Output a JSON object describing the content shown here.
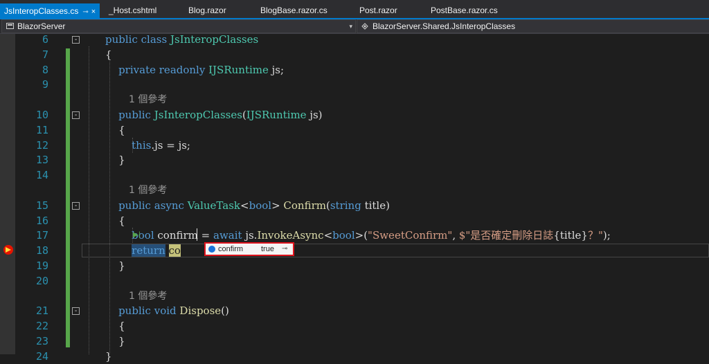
{
  "tabs": [
    {
      "label": "JsInteropClasses.cs",
      "pin": "⊸",
      "close": "×"
    },
    {
      "label": "_Host.cshtml"
    },
    {
      "label": "Blog.razor"
    },
    {
      "label": "BlogBase.razor.cs"
    },
    {
      "label": "Post.razor"
    },
    {
      "label": "PostBase.razor.cs"
    }
  ],
  "nav": {
    "project": "BlazorServer",
    "type": "BlazorServer.Shared.JsInteropClasses",
    "dropdown_glyph": "▾"
  },
  "code_lines": [
    {
      "num": "6",
      "kind": "code",
      "html": "<span class=\"kw\">public</span> <span class=\"kw\">class</span> <span class=\"ty\">JsInteropClasses</span>"
    },
    {
      "num": "7",
      "kind": "code",
      "html": "{"
    },
    {
      "num": "8",
      "kind": "code",
      "html": "    <span class=\"kw\">private</span> <span class=\"kw\">readonly</span> <span class=\"ty\">IJSRuntime</span> js;"
    },
    {
      "num": "9",
      "kind": "code",
      "html": ""
    },
    {
      "num": "",
      "kind": "lens",
      "text": "1 個參考"
    },
    {
      "num": "10",
      "kind": "code",
      "html": "    <span class=\"kw\">public</span> <span class=\"ty\">JsInteropClasses</span>(<span class=\"ty\">IJSRuntime</span> js)"
    },
    {
      "num": "11",
      "kind": "code",
      "html": "    {"
    },
    {
      "num": "12",
      "kind": "code",
      "html": "        <span class=\"kw\">this</span>.js = js;"
    },
    {
      "num": "13",
      "kind": "code",
      "html": "    }"
    },
    {
      "num": "14",
      "kind": "code",
      "html": ""
    },
    {
      "num": "",
      "kind": "lens",
      "text": "1 個參考"
    },
    {
      "num": "15",
      "kind": "code",
      "html": "    <span class=\"kw\">public</span> <span class=\"kw\">async</span> <span class=\"ty\">ValueTask</span>&lt;<span class=\"kw\">bool</span>&gt; <span class=\"mt\">Confirm</span>(<span class=\"kw\">string</span> title)"
    },
    {
      "num": "16",
      "kind": "code",
      "html": "    {"
    },
    {
      "num": "17",
      "kind": "code",
      "html": "        <span class=\"kw\">bool</span> confirm = <span class=\"kw\">await</span> js.<span class=\"mt\">InvokeAsync</span>&lt;<span class=\"kw\">bool</span>&gt;(<span class=\"st\">\"SweetConfirm\"</span>, <span class=\"st\">$\"是否確定刪除日誌</span>{title}<span class=\"st\">？\"</span>);"
    },
    {
      "num": "18",
      "kind": "code",
      "html": "        <span class=\"retsel\"><span class=\"kw\">return</span></span> <span class=\"retword\">co</span>"
    },
    {
      "num": "19",
      "kind": "code",
      "html": "    }"
    },
    {
      "num": "20",
      "kind": "code",
      "html": ""
    },
    {
      "num": "",
      "kind": "lens",
      "text": "1 個參考"
    },
    {
      "num": "21",
      "kind": "code",
      "html": "    <span class=\"kw\">public</span> <span class=\"kw\">void</span> <span class=\"mt\">Dispose</span>()"
    },
    {
      "num": "22",
      "kind": "code",
      "html": "    {"
    },
    {
      "num": "23",
      "kind": "code",
      "html": "    }"
    },
    {
      "num": "24",
      "kind": "code",
      "html": "}"
    }
  ],
  "datatip": {
    "name": "confirm",
    "value": "true",
    "pin": "⊸"
  },
  "run_arrow": "▶|",
  "fold_glyph": "⊟"
}
